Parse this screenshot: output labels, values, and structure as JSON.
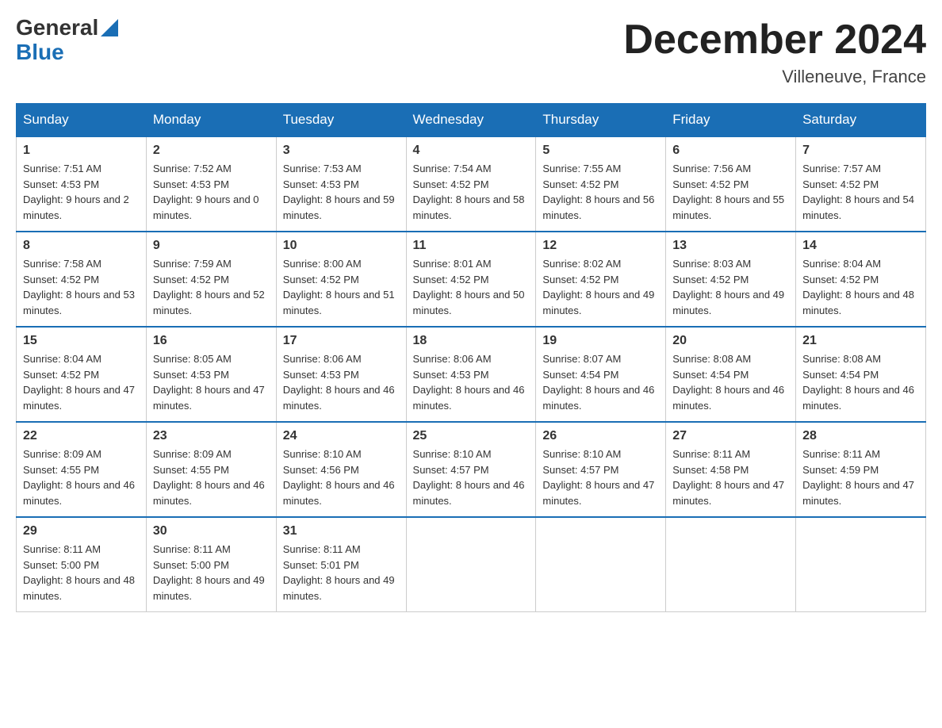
{
  "header": {
    "logo_general": "General",
    "logo_blue": "Blue",
    "month_title": "December 2024",
    "location": "Villeneuve, France"
  },
  "weekdays": [
    "Sunday",
    "Monday",
    "Tuesday",
    "Wednesday",
    "Thursday",
    "Friday",
    "Saturday"
  ],
  "weeks": [
    [
      {
        "day": "1",
        "sunrise": "7:51 AM",
        "sunset": "4:53 PM",
        "daylight": "9 hours and 2 minutes."
      },
      {
        "day": "2",
        "sunrise": "7:52 AM",
        "sunset": "4:53 PM",
        "daylight": "9 hours and 0 minutes."
      },
      {
        "day": "3",
        "sunrise": "7:53 AM",
        "sunset": "4:53 PM",
        "daylight": "8 hours and 59 minutes."
      },
      {
        "day": "4",
        "sunrise": "7:54 AM",
        "sunset": "4:52 PM",
        "daylight": "8 hours and 58 minutes."
      },
      {
        "day": "5",
        "sunrise": "7:55 AM",
        "sunset": "4:52 PM",
        "daylight": "8 hours and 56 minutes."
      },
      {
        "day": "6",
        "sunrise": "7:56 AM",
        "sunset": "4:52 PM",
        "daylight": "8 hours and 55 minutes."
      },
      {
        "day": "7",
        "sunrise": "7:57 AM",
        "sunset": "4:52 PM",
        "daylight": "8 hours and 54 minutes."
      }
    ],
    [
      {
        "day": "8",
        "sunrise": "7:58 AM",
        "sunset": "4:52 PM",
        "daylight": "8 hours and 53 minutes."
      },
      {
        "day": "9",
        "sunrise": "7:59 AM",
        "sunset": "4:52 PM",
        "daylight": "8 hours and 52 minutes."
      },
      {
        "day": "10",
        "sunrise": "8:00 AM",
        "sunset": "4:52 PM",
        "daylight": "8 hours and 51 minutes."
      },
      {
        "day": "11",
        "sunrise": "8:01 AM",
        "sunset": "4:52 PM",
        "daylight": "8 hours and 50 minutes."
      },
      {
        "day": "12",
        "sunrise": "8:02 AM",
        "sunset": "4:52 PM",
        "daylight": "8 hours and 49 minutes."
      },
      {
        "day": "13",
        "sunrise": "8:03 AM",
        "sunset": "4:52 PM",
        "daylight": "8 hours and 49 minutes."
      },
      {
        "day": "14",
        "sunrise": "8:04 AM",
        "sunset": "4:52 PM",
        "daylight": "8 hours and 48 minutes."
      }
    ],
    [
      {
        "day": "15",
        "sunrise": "8:04 AM",
        "sunset": "4:52 PM",
        "daylight": "8 hours and 47 minutes."
      },
      {
        "day": "16",
        "sunrise": "8:05 AM",
        "sunset": "4:53 PM",
        "daylight": "8 hours and 47 minutes."
      },
      {
        "day": "17",
        "sunrise": "8:06 AM",
        "sunset": "4:53 PM",
        "daylight": "8 hours and 46 minutes."
      },
      {
        "day": "18",
        "sunrise": "8:06 AM",
        "sunset": "4:53 PM",
        "daylight": "8 hours and 46 minutes."
      },
      {
        "day": "19",
        "sunrise": "8:07 AM",
        "sunset": "4:54 PM",
        "daylight": "8 hours and 46 minutes."
      },
      {
        "day": "20",
        "sunrise": "8:08 AM",
        "sunset": "4:54 PM",
        "daylight": "8 hours and 46 minutes."
      },
      {
        "day": "21",
        "sunrise": "8:08 AM",
        "sunset": "4:54 PM",
        "daylight": "8 hours and 46 minutes."
      }
    ],
    [
      {
        "day": "22",
        "sunrise": "8:09 AM",
        "sunset": "4:55 PM",
        "daylight": "8 hours and 46 minutes."
      },
      {
        "day": "23",
        "sunrise": "8:09 AM",
        "sunset": "4:55 PM",
        "daylight": "8 hours and 46 minutes."
      },
      {
        "day": "24",
        "sunrise": "8:10 AM",
        "sunset": "4:56 PM",
        "daylight": "8 hours and 46 minutes."
      },
      {
        "day": "25",
        "sunrise": "8:10 AM",
        "sunset": "4:57 PM",
        "daylight": "8 hours and 46 minutes."
      },
      {
        "day": "26",
        "sunrise": "8:10 AM",
        "sunset": "4:57 PM",
        "daylight": "8 hours and 47 minutes."
      },
      {
        "day": "27",
        "sunrise": "8:11 AM",
        "sunset": "4:58 PM",
        "daylight": "8 hours and 47 minutes."
      },
      {
        "day": "28",
        "sunrise": "8:11 AM",
        "sunset": "4:59 PM",
        "daylight": "8 hours and 47 minutes."
      }
    ],
    [
      {
        "day": "29",
        "sunrise": "8:11 AM",
        "sunset": "5:00 PM",
        "daylight": "8 hours and 48 minutes."
      },
      {
        "day": "30",
        "sunrise": "8:11 AM",
        "sunset": "5:00 PM",
        "daylight": "8 hours and 49 minutes."
      },
      {
        "day": "31",
        "sunrise": "8:11 AM",
        "sunset": "5:01 PM",
        "daylight": "8 hours and 49 minutes."
      },
      null,
      null,
      null,
      null
    ]
  ],
  "labels": {
    "sunrise": "Sunrise:",
    "sunset": "Sunset:",
    "daylight": "Daylight:"
  }
}
